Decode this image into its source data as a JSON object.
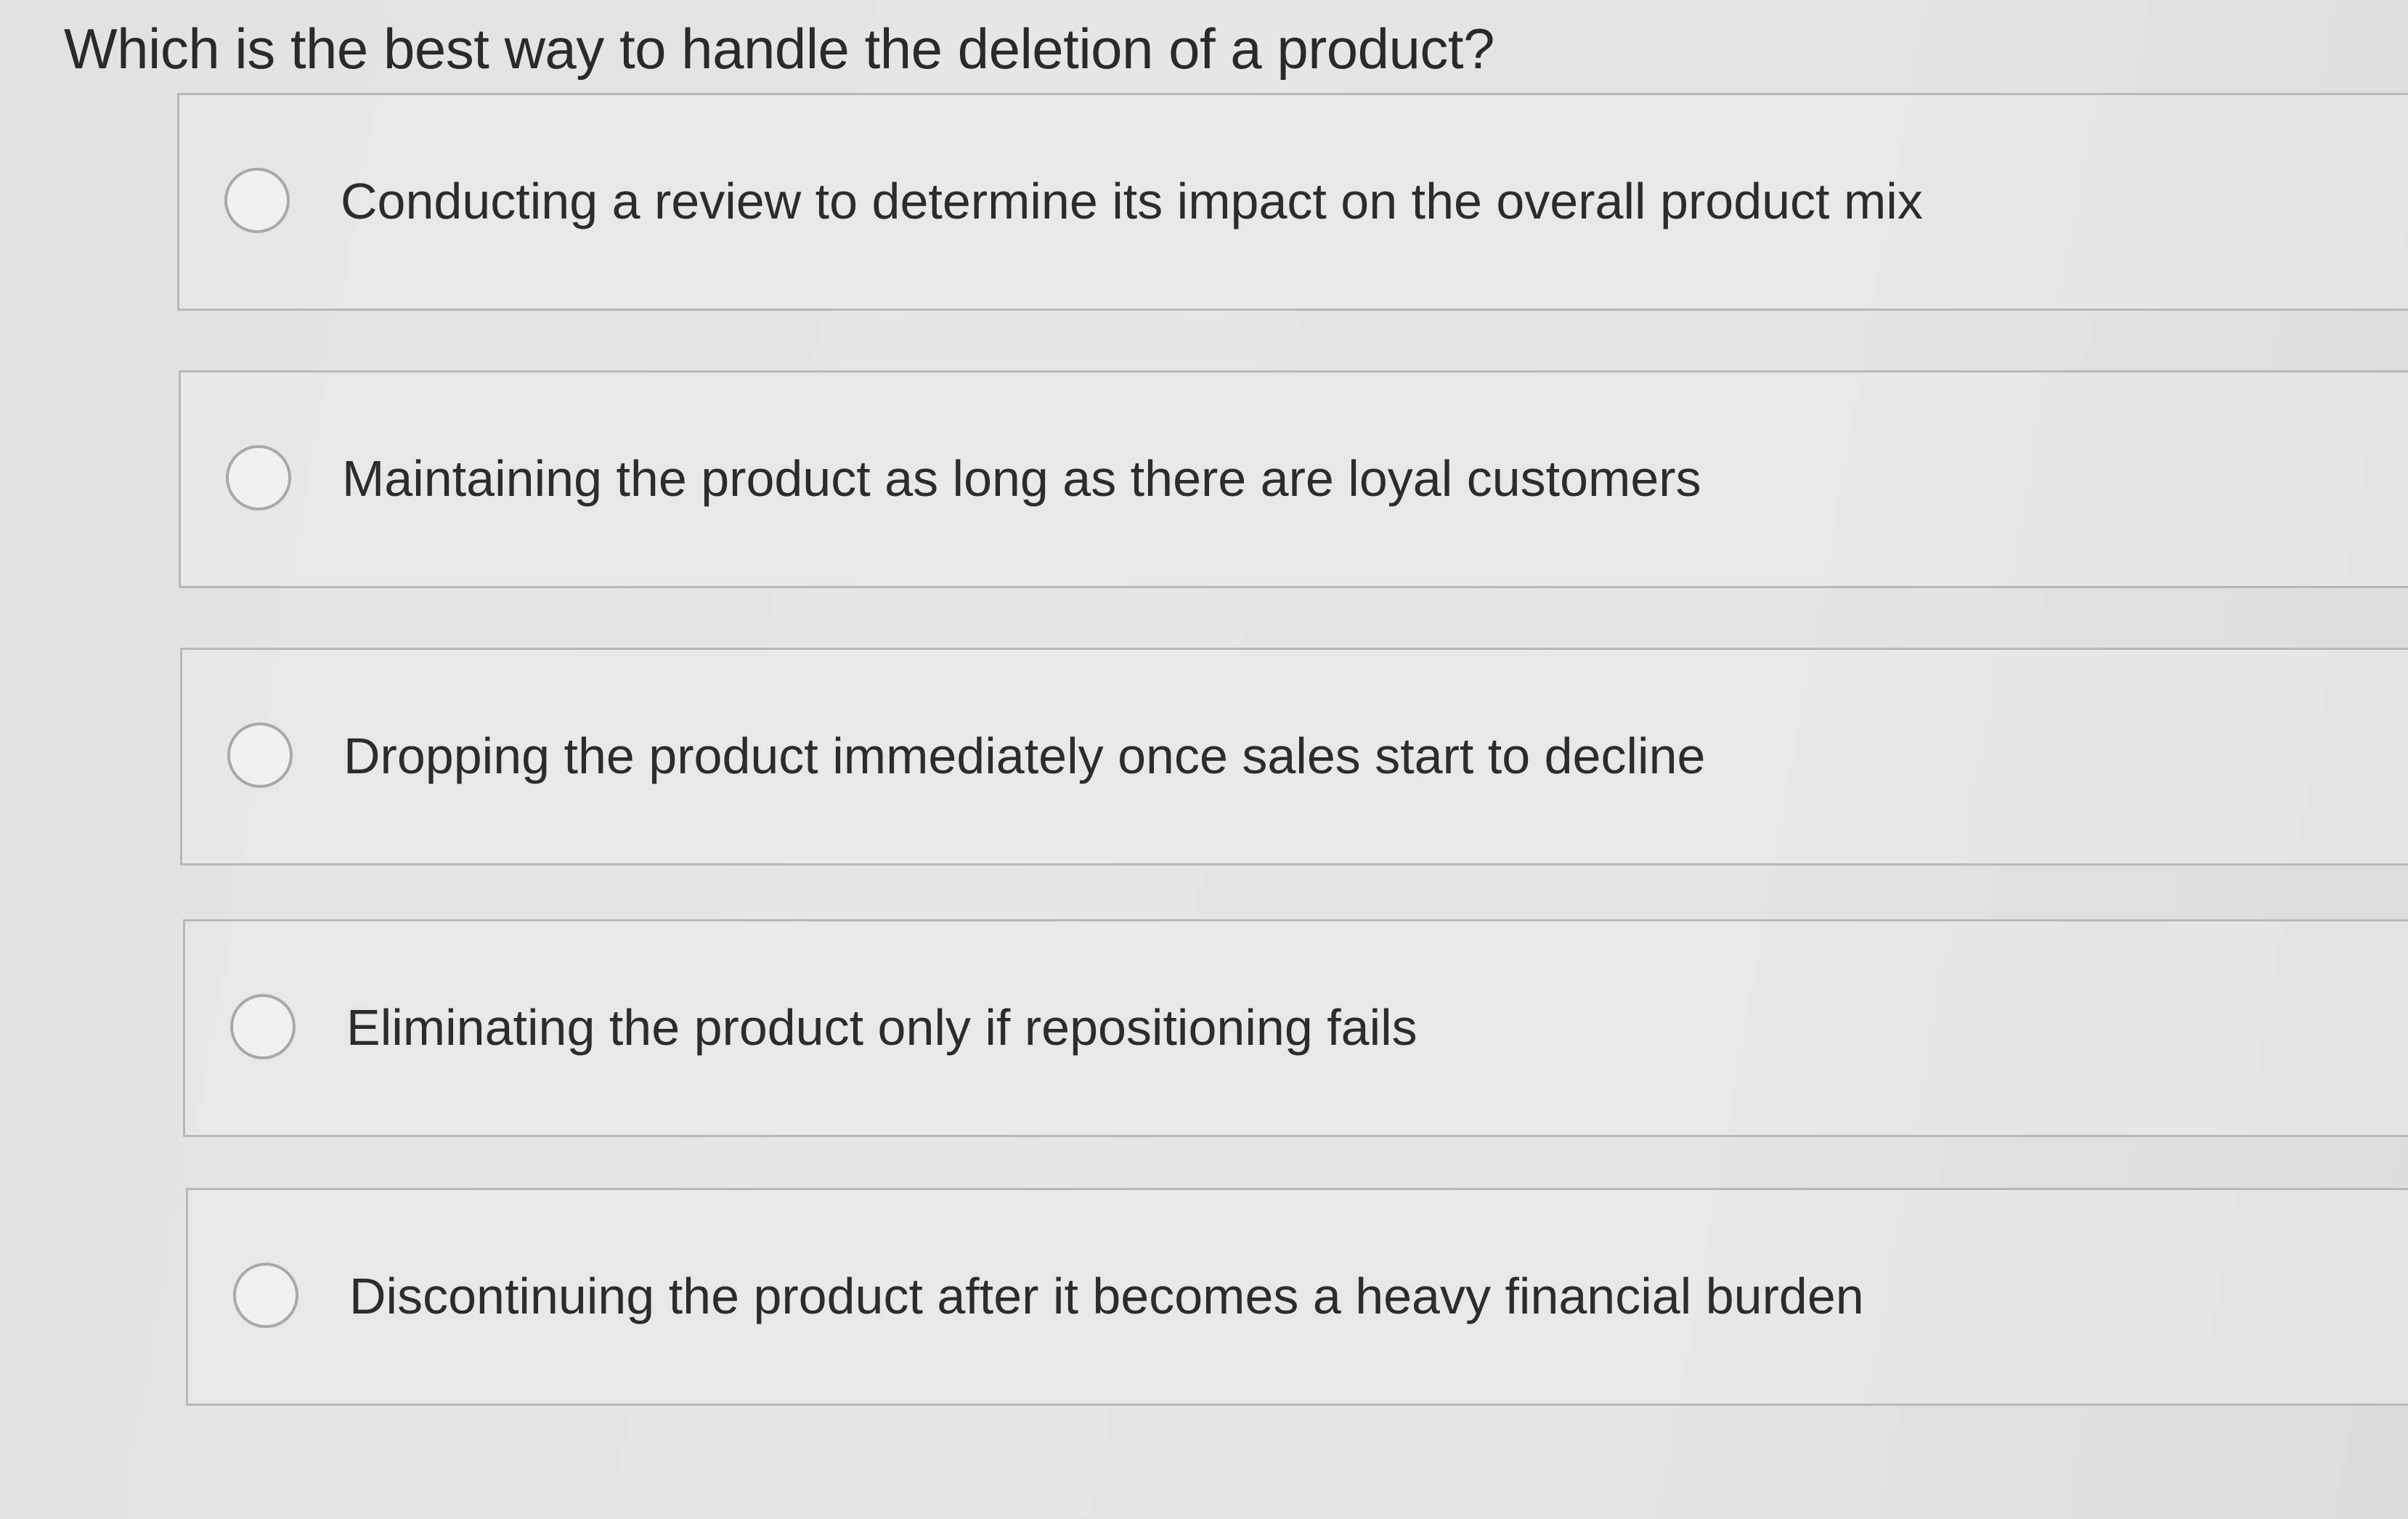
{
  "question": {
    "text": "Which is the best way to handle the deletion of a product?"
  },
  "options": [
    {
      "label": "Conducting a review to determine its impact on the overall product mix",
      "selected": false
    },
    {
      "label": "Maintaining the product as long as there are loyal customers",
      "selected": false
    },
    {
      "label": "Dropping the product immediately once sales start to decline",
      "selected": false
    },
    {
      "label": "Eliminating the product only if repositioning fails",
      "selected": false
    },
    {
      "label": "Discontinuing the product after it becomes a heavy financial burden",
      "selected": false
    }
  ],
  "colors": {
    "background": "#e4e4e2",
    "border": "#b8b8b6",
    "radio_border": "#a9a9a7",
    "text": "#2c2c2c"
  }
}
